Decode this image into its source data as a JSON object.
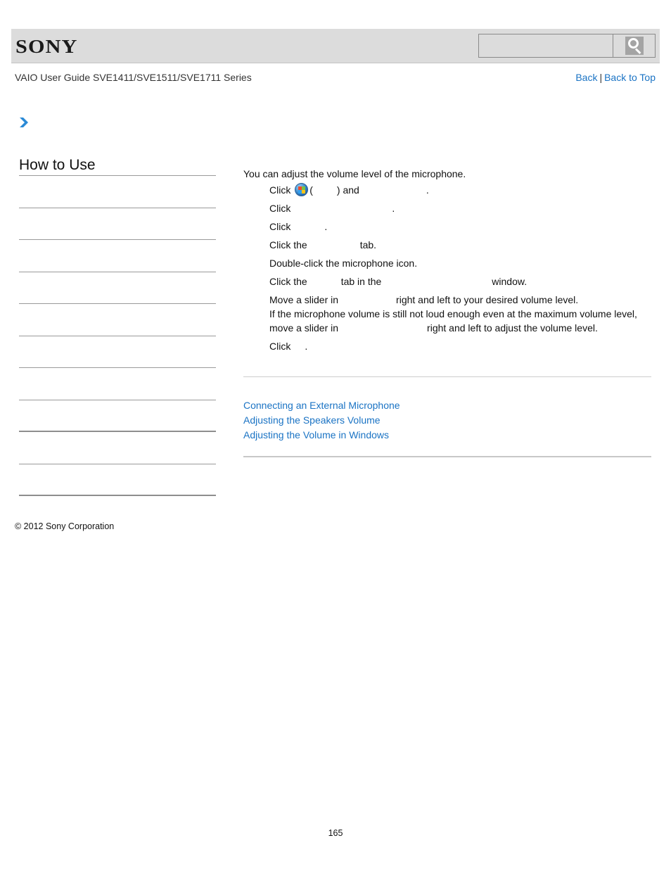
{
  "header": {
    "brand": "SONY",
    "search": {
      "placeholder": "",
      "value": "",
      "button_icon": "search-icon"
    }
  },
  "guide_title": "VAIO User Guide SVE1411/SVE1511/SVE1711 Series",
  "nav": {
    "back": "Back",
    "separator": "|",
    "back_to_top": "Back to Top"
  },
  "breadcrumb": {
    "icon": "chevron-right-icon",
    "color": "#2b8ad6"
  },
  "sidebar": {
    "title": "How to Use",
    "item_count": 10
  },
  "content": {
    "intro": "You can adjust the volume level of the microphone.",
    "steps": [
      {
        "parts": [
          "Click",
          "(",
          ") and",
          "."
        ],
        "has_start_icon": true
      },
      {
        "parts": [
          "Click",
          "."
        ]
      },
      {
        "parts": [
          "Click",
          "."
        ]
      },
      {
        "parts": [
          "Click the",
          "tab."
        ]
      },
      {
        "parts": [
          "Double-click the microphone icon."
        ]
      },
      {
        "parts": [
          "Click the",
          "tab in the",
          "window."
        ]
      },
      {
        "parts": [
          "Move a slider in",
          "right and left to your desired volume level."
        ],
        "extra_line_1": "If the microphone volume is still not loud enough even at the maximum volume level,",
        "extra_line_2_parts": [
          "move a slider in",
          "right and left to adjust the volume level."
        ]
      },
      {
        "parts": [
          "Click",
          "."
        ]
      }
    ]
  },
  "related_topics": [
    "Connecting an External Microphone",
    "Adjusting the Speakers Volume",
    "Adjusting the Volume in Windows"
  ],
  "footer": {
    "copyright": "© 2012 Sony Corporation",
    "page_number": "165"
  },
  "colors": {
    "link": "#1a73c4",
    "header_bg": "#dcdcdc"
  }
}
